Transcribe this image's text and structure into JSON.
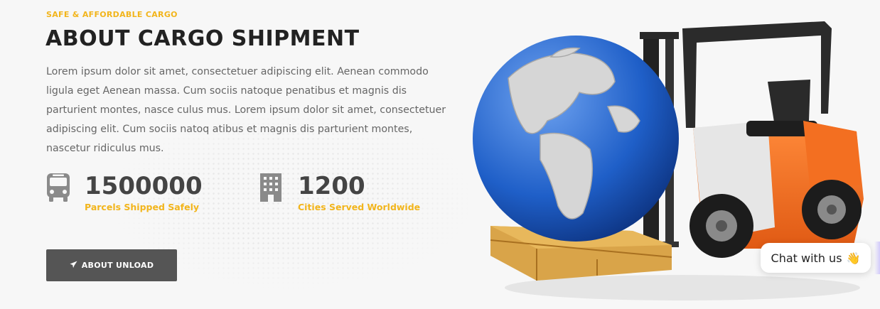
{
  "hero": {
    "eyebrow": "SAFE & AFFORDABLE CARGO",
    "title": "ABOUT CARGO SHIPMENT",
    "description": "Lorem ipsum dolor sit amet, consectetuer adipiscing elit. Aenean commodo ligula eget Aenean massa. Cum sociis natoque penatibus et magnis dis parturient montes, nasce culus mus. Lorem ipsum dolor sit amet, consectetuer adipiscing elit. Cum sociis natoq atibus et magnis dis parturient montes, nascetur ridiculus mus."
  },
  "stats": [
    {
      "icon": "bus-icon",
      "value": "1500000",
      "label": "Parcels Shipped Safely"
    },
    {
      "icon": "building-icon",
      "value": "1200",
      "label": "Cities Served Worldwide"
    }
  ],
  "button": {
    "label": "ABOUT UNLOAD",
    "icon": "paper-plane-icon"
  },
  "chat": {
    "label": "Chat with us",
    "emoji": "👋"
  },
  "colors": {
    "accent": "#f2b51c",
    "heading": "#222222",
    "button_bg": "#555555",
    "forklift_orange": "#f36f21",
    "globe_blue": "#1f5fc8"
  }
}
